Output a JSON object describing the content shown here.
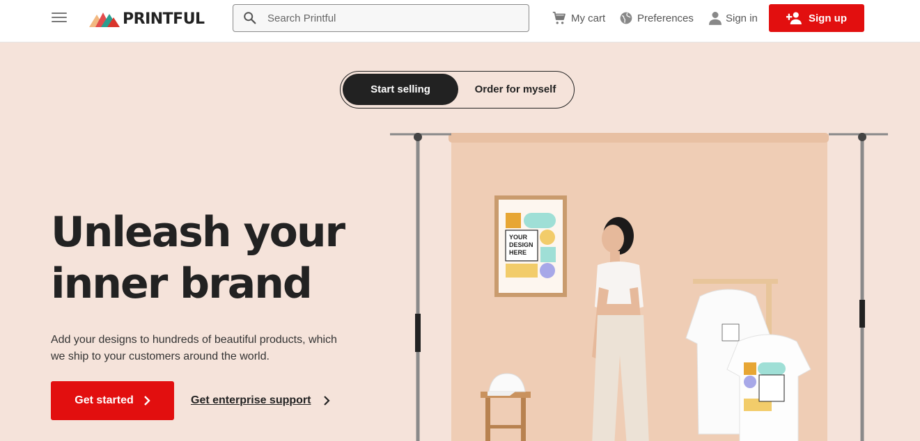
{
  "header": {
    "logo_text": "PRINTFUL",
    "search_placeholder": "Search Printful",
    "cart_label": "My cart",
    "preferences_label": "Preferences",
    "signin_label": "Sign in",
    "signup_label": "Sign up"
  },
  "hero": {
    "toggle": {
      "active_label": "Start selling",
      "inactive_label": "Order for myself"
    },
    "headline_line1": "Unleash your",
    "headline_line2": "inner brand",
    "subtext": "Add your designs to hundreds of beautiful products, which we ship to your customers around the world.",
    "primary_cta": "Get started",
    "secondary_cta": "Get enterprise support",
    "mockup_text_poster_l1": "YOUR",
    "mockup_text_poster_l2": "DESIGN",
    "mockup_text_poster_l3": "HERE"
  },
  "colors": {
    "brand_red": "#e20f0f",
    "hero_bg": "#f5e3da",
    "backdrop": "#efcdb5",
    "text_dark": "#222222"
  },
  "icons": {
    "menu": "hamburger-icon",
    "search": "search-icon",
    "cart": "cart-icon",
    "preferences": "globe-icon",
    "signin": "user-icon",
    "signup": "add-user-icon",
    "chevron": "chevron-right-icon"
  }
}
